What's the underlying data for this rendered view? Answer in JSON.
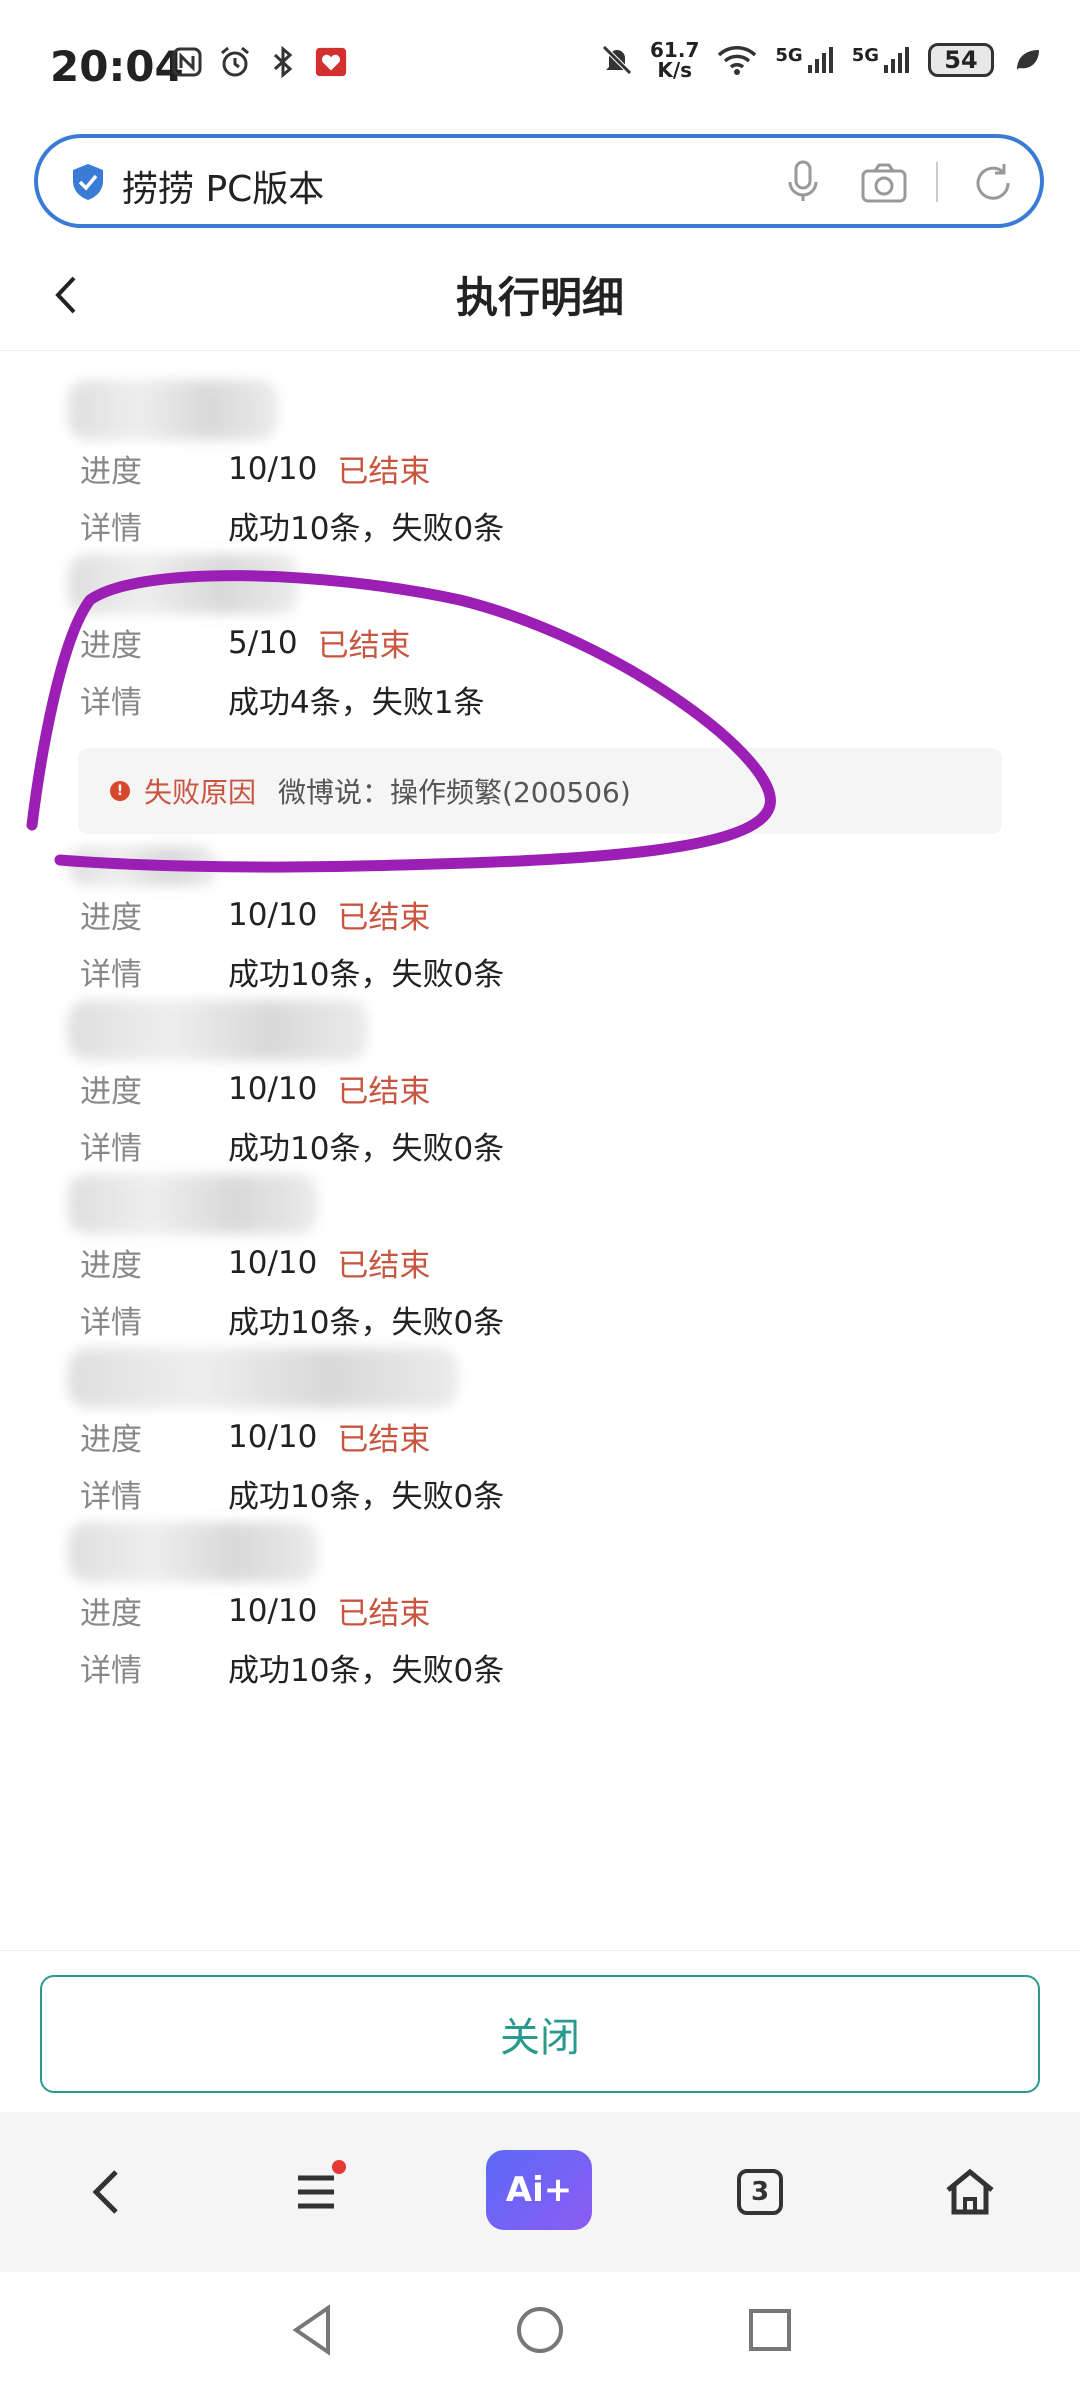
{
  "status_bar": {
    "time": "20:04",
    "net_speed_value": "61.7",
    "net_speed_unit": "K/s",
    "signal1": "5G",
    "signal2": "5G",
    "battery": "54"
  },
  "search": {
    "text": "捞捞 PC版本"
  },
  "header": {
    "title": "执行明细"
  },
  "labels": {
    "progress": "进度",
    "detail": "详情"
  },
  "tasks": [
    {
      "progress": "10/10",
      "status": "已结束",
      "detail": "成功10条，失败0条"
    },
    {
      "progress": "5/10",
      "status": "已结束",
      "detail": "成功4条，失败1条",
      "fail_label": "失败原因",
      "fail_msg": "微博说：操作频繁(200506)"
    },
    {
      "progress": "10/10",
      "status": "已结束",
      "detail": "成功10条，失败0条"
    },
    {
      "progress": "10/10",
      "status": "已结束",
      "detail": "成功10条，失败0条"
    },
    {
      "progress": "10/10",
      "status": "已结束",
      "detail": "成功10条，失败0条"
    },
    {
      "progress": "10/10",
      "status": "已结束",
      "detail": "成功10条，失败0条"
    },
    {
      "progress": "10/10",
      "status": "已结束",
      "detail": "成功10条，失败0条"
    }
  ],
  "close_button": "关闭",
  "toolbar": {
    "ai_label": "Ai+",
    "tab_count": "3"
  },
  "colors": {
    "accent": "#2b9a8e",
    "status_red": "#c9543f",
    "annotation": "#9b1fb5",
    "search_border": "#3a7bd5"
  }
}
